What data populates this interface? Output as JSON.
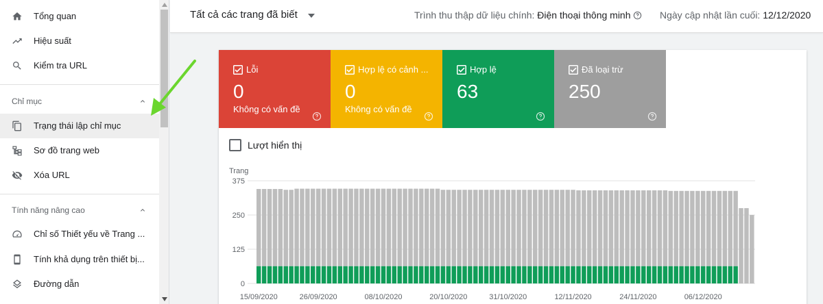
{
  "sidebar": {
    "items_top": [
      {
        "label": "Tổng quan",
        "icon": "home-icon"
      },
      {
        "label": "Hiệu suất",
        "icon": "trending-up-icon"
      },
      {
        "label": "Kiểm tra URL",
        "icon": "search-icon"
      }
    ],
    "section_index": {
      "title": "Chỉ mục",
      "items": [
        {
          "label": "Trạng thái lập chỉ mục",
          "icon": "copy-pages-icon",
          "active": true
        },
        {
          "label": "Sơ đồ trang web",
          "icon": "sitemap-icon"
        },
        {
          "label": "Xóa URL",
          "icon": "eye-off-icon"
        }
      ]
    },
    "section_advanced": {
      "title": "Tính năng nâng cao",
      "items": [
        {
          "label": "Chỉ số Thiết yếu về Trang ...",
          "icon": "speedometer-icon"
        },
        {
          "label": "Tính khả dụng trên thiết bị...",
          "icon": "phone-icon"
        },
        {
          "label": "Đường dẫn",
          "icon": "layers-icon"
        }
      ]
    }
  },
  "topbar": {
    "filter": "Tất cả các trang đã biết",
    "crawler_label": "Trình thu thập dữ liệu chính:",
    "crawler_value": "Điện thoại thông minh",
    "updated_label": "Ngày cập nhật lần cuối:",
    "updated_value": "12/12/2020"
  },
  "tiles": [
    {
      "label": "Lỗi",
      "value": "0",
      "sub": "Không có vấn đề",
      "color": "#db4437"
    },
    {
      "label": "Hợp lệ có cảnh ...",
      "value": "0",
      "sub": "Không có vấn đề",
      "color": "#f4b400"
    },
    {
      "label": "Hợp lệ",
      "value": "63",
      "sub": "",
      "color": "#0f9d58"
    },
    {
      "label": "Đã loại trừ",
      "value": "250",
      "sub": "",
      "color": "#9e9e9e"
    }
  ],
  "impressions_label": "Lượt hiển thị",
  "chart_data": {
    "type": "bar",
    "stacked": true,
    "ylabel": "Trang",
    "ylim": [
      0,
      375
    ],
    "yticks": [
      0,
      125,
      250,
      375
    ],
    "xtick_labels": [
      "15/09/2020",
      "26/09/2020",
      "08/10/2020",
      "20/10/2020",
      "31/10/2020",
      "12/11/2020",
      "24/11/2020",
      "06/12/2020"
    ],
    "x_start": "15/09/2020",
    "series": [
      {
        "name": "Hợp lệ",
        "color": "#0f9d58",
        "values": [
          63,
          63,
          63,
          63,
          63,
          63,
          63,
          63,
          63,
          63,
          63,
          63,
          63,
          63,
          63,
          63,
          63,
          63,
          63,
          63,
          63,
          63,
          63,
          63,
          63,
          63,
          63,
          63,
          63,
          63,
          63,
          63,
          63,
          63,
          63,
          63,
          63,
          63,
          63,
          63,
          63,
          63,
          63,
          63,
          63,
          63,
          63,
          63,
          63,
          63,
          63,
          63,
          63,
          63,
          63,
          63,
          63,
          63,
          63,
          63,
          63,
          63,
          63,
          63,
          63,
          63,
          63,
          63,
          63,
          63,
          63,
          63,
          63,
          63,
          63,
          63,
          63,
          63,
          63,
          63,
          63,
          63,
          63,
          63,
          63,
          63,
          63,
          63,
          63
        ]
      },
      {
        "name": "Đã loại trừ",
        "color": "#bdbdbd",
        "values": [
          282,
          282,
          282,
          282,
          282,
          279,
          279,
          283,
          283,
          283,
          283,
          283,
          283,
          283,
          283,
          283,
          283,
          283,
          283,
          283,
          283,
          283,
          283,
          283,
          283,
          283,
          283,
          283,
          283,
          283,
          283,
          283,
          283,
          283,
          279,
          279,
          279,
          279,
          279,
          279,
          279,
          279,
          279,
          279,
          279,
          279,
          279,
          279,
          279,
          279,
          279,
          279,
          279,
          279,
          279,
          279,
          279,
          279,
          279,
          277,
          277,
          277,
          277,
          277,
          277,
          277,
          277,
          277,
          277,
          277,
          277,
          277,
          277,
          277,
          277,
          277,
          275,
          275,
          275,
          275,
          275,
          275,
          275,
          275,
          275,
          275,
          275,
          275,
          275,
          275,
          275,
          250
        ]
      }
    ]
  }
}
